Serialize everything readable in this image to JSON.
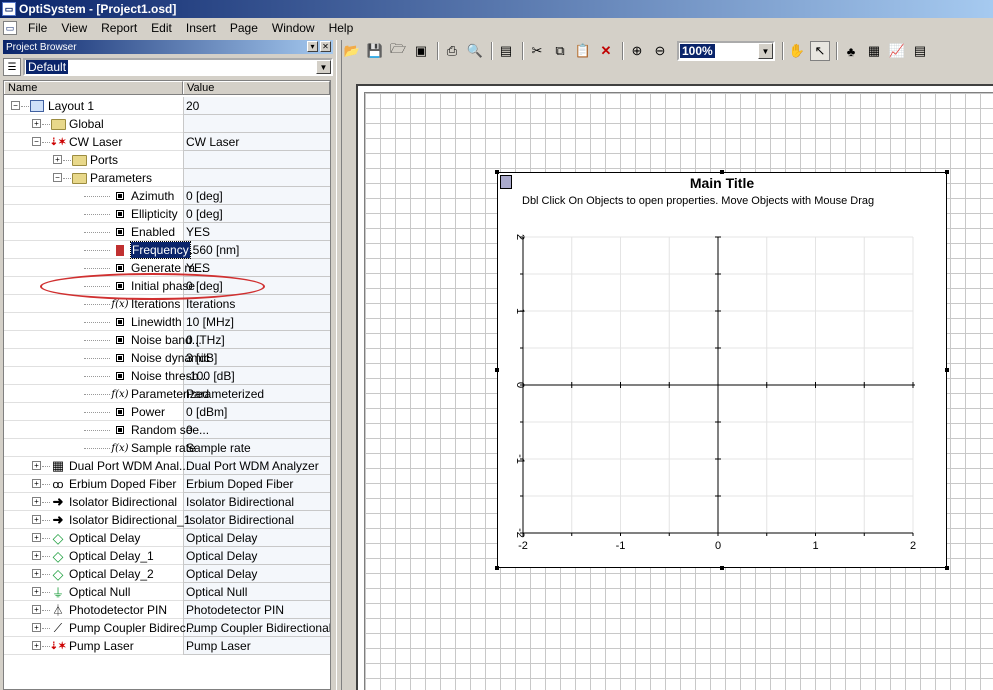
{
  "window": {
    "title": "OptiSystem - [Project1.osd]"
  },
  "menu": [
    "File",
    "View",
    "Report",
    "Edit",
    "Insert",
    "Page",
    "Window",
    "Help"
  ],
  "project_browser": {
    "title": "Project Browser",
    "layout_select": "Default",
    "columns": {
      "name": "Name",
      "value": "Value"
    },
    "rows": [
      {
        "label": "Layout 1",
        "value": "20",
        "indent": 0,
        "expander": "−",
        "icon": "layout-icon"
      },
      {
        "label": "Global",
        "value": "",
        "indent": 1,
        "expander": "+",
        "icon": "folder-icon"
      },
      {
        "label": "CW Laser",
        "value": "CW Laser",
        "indent": 1,
        "expander": "−",
        "icon": "laser-icon"
      },
      {
        "label": "Ports",
        "value": "",
        "indent": 2,
        "expander": "+",
        "icon": "folder-icon"
      },
      {
        "label": "Parameters",
        "value": "",
        "indent": 2,
        "expander": "−",
        "icon": "folder-icon"
      },
      {
        "label": "Azimuth",
        "value": "0 [deg]",
        "indent": 3,
        "icon": "parameter-icon"
      },
      {
        "label": "Ellipticity",
        "value": "0 [deg]",
        "indent": 3,
        "icon": "parameter-icon"
      },
      {
        "label": "Enabled",
        "value": "YES",
        "indent": 3,
        "icon": "parameter-icon"
      },
      {
        "label": "Frequency",
        "value": "1560 [nm]",
        "indent": 3,
        "icon": "parameter-selected-icon",
        "selected": true
      },
      {
        "label": "Generate ra...",
        "value": "YES",
        "indent": 3,
        "icon": "parameter-icon"
      },
      {
        "label": "Initial phase",
        "value": "0 [deg]",
        "indent": 3,
        "icon": "parameter-icon"
      },
      {
        "label": "Iterations",
        "value": "Iterations",
        "indent": 3,
        "icon": "function-icon"
      },
      {
        "label": "Linewidth",
        "value": "10 [MHz]",
        "indent": 3,
        "icon": "parameter-icon"
      },
      {
        "label": "Noise band...",
        "value": "0 [THz]",
        "indent": 3,
        "icon": "parameter-icon"
      },
      {
        "label": "Noise dynamic",
        "value": "3 [dB]",
        "indent": 3,
        "icon": "parameter-icon"
      },
      {
        "label": "Noise thresh...",
        "value": "-100 [dB]",
        "indent": 3,
        "icon": "parameter-icon"
      },
      {
        "label": "Parameterized",
        "value": "Parameterized",
        "indent": 3,
        "icon": "function-icon"
      },
      {
        "label": "Power",
        "value": "0 [dBm]",
        "indent": 3,
        "icon": "parameter-icon"
      },
      {
        "label": "Random see...",
        "value": "0",
        "indent": 3,
        "icon": "parameter-icon"
      },
      {
        "label": "Sample rate",
        "value": "Sample rate",
        "indent": 3,
        "icon": "function-icon"
      },
      {
        "label": "Dual Port WDM Anal...",
        "value": "Dual Port WDM Analyzer",
        "indent": 1,
        "expander": "+",
        "icon": "analyzer-icon"
      },
      {
        "label": "Erbium Doped Fiber",
        "value": "Erbium Doped Fiber",
        "indent": 1,
        "expander": "+",
        "icon": "fiber-icon"
      },
      {
        "label": "Isolator Bidirectional",
        "value": "Isolator Bidirectional",
        "indent": 1,
        "expander": "+",
        "icon": "arrow-right-icon"
      },
      {
        "label": "Isolator Bidirectional_1",
        "value": "Isolator Bidirectional",
        "indent": 1,
        "expander": "+",
        "icon": "arrow-right-icon"
      },
      {
        "label": "Optical Delay",
        "value": "Optical Delay",
        "indent": 1,
        "expander": "+",
        "icon": "diamond-icon"
      },
      {
        "label": "Optical Delay_1",
        "value": "Optical Delay",
        "indent": 1,
        "expander": "+",
        "icon": "diamond-icon"
      },
      {
        "label": "Optical Delay_2",
        "value": "Optical Delay",
        "indent": 1,
        "expander": "+",
        "icon": "diamond-icon"
      },
      {
        "label": "Optical Null",
        "value": "Optical Null",
        "indent": 1,
        "expander": "+",
        "icon": "ground-icon"
      },
      {
        "label": "Photodetector PIN",
        "value": "Photodetector PIN",
        "indent": 1,
        "expander": "+",
        "icon": "photodiode-icon"
      },
      {
        "label": "Pump Coupler Bidirec...",
        "value": "Pump Coupler Bidirectional",
        "indent": 1,
        "expander": "+",
        "icon": "coupler-icon"
      },
      {
        "label": "Pump Laser",
        "value": "Pump Laser",
        "indent": 1,
        "expander": "+",
        "icon": "laser-icon"
      }
    ]
  },
  "toolbar": {
    "zoom": "100%",
    "buttons": [
      "open-folder-icon",
      "save-icon",
      "save-as-icon",
      "save-all-icon",
      "print-icon",
      "print-preview-icon",
      "properties-icon",
      "cut-icon",
      "copy-icon",
      "paste-icon",
      "delete-icon",
      "zoom-in-icon",
      "zoom-out-icon",
      "hand-pan-icon",
      "pointer-icon",
      "component-library-icon",
      "table-icon",
      "graph-icon",
      "report-icon"
    ]
  },
  "graph": {
    "title": "Main Title",
    "subtitle": "Dbl Click On Objects to open properties.  Move Objects with Mouse Drag"
  },
  "chart_data": {
    "type": "line",
    "title": "Main Title",
    "xlabel": "",
    "ylabel": "",
    "xlim": [
      -2,
      2
    ],
    "ylim": [
      -2,
      2
    ],
    "x_ticks": [
      "-2",
      "-1",
      "0",
      "1",
      "2"
    ],
    "y_ticks": [
      "2",
      "1",
      "0",
      "-1",
      "-2"
    ],
    "grid": true,
    "series": []
  }
}
